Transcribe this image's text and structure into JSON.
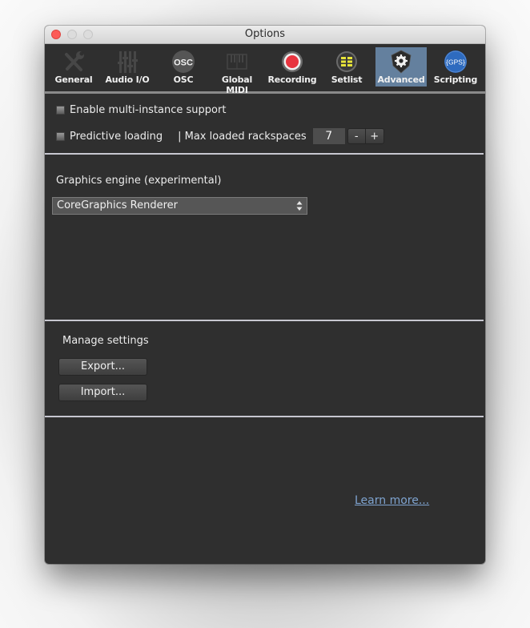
{
  "window": {
    "title": "Options"
  },
  "toolbar": {
    "tabs": [
      {
        "label": "General",
        "icon": "wrench-screwdriver-icon",
        "active": false,
        "enabled": false
      },
      {
        "label": "Audio I/O",
        "icon": "mixer-faders-icon",
        "active": false,
        "enabled": false
      },
      {
        "label": "OSC",
        "icon": "osc-icon",
        "icon_text": "OSC",
        "active": false
      },
      {
        "label": "Global MIDI",
        "icon": "piano-keyboard-icon",
        "active": false,
        "enabled": false
      },
      {
        "label": "Recording",
        "icon": "record-icon",
        "active": false
      },
      {
        "label": "Setlist",
        "icon": "setlist-icon",
        "active": false
      },
      {
        "label": "Advanced",
        "icon": "shield-gear-icon",
        "active": true
      },
      {
        "label": "Scripting",
        "icon": "gps-icon",
        "icon_text": "{GPS}",
        "active": false
      }
    ]
  },
  "advanced": {
    "multi_instance": {
      "label": "Enable multi-instance support",
      "checked": false
    },
    "predictive_loading": {
      "label": "Predictive loading",
      "checked": false
    },
    "max_rackspaces": {
      "label": "| Max loaded rackspaces",
      "value": "7",
      "decrement": "-",
      "increment": "+"
    },
    "graphics": {
      "label": "Graphics engine (experimental)",
      "selected": "CoreGraphics Renderer"
    },
    "manage": {
      "label": "Manage settings",
      "export_label": "Export...",
      "import_label": "Import..."
    },
    "learn_more": "Learn more..."
  },
  "colors": {
    "active_tab": "#64809e",
    "record_red": "#e8343f",
    "setlist_yellow": "#e7e43a",
    "gps_blue": "#2e6bbf",
    "link": "#7ea3cf"
  }
}
